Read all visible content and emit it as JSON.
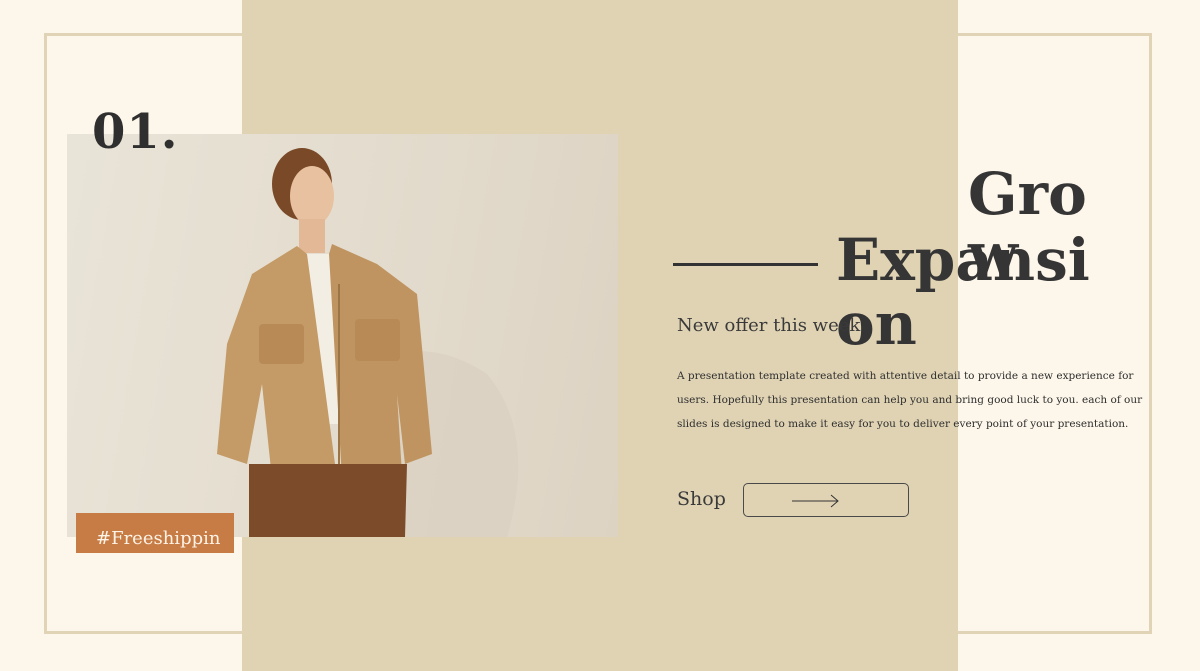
{
  "slide": {
    "number": "01.",
    "promo_tag": "#Freeshipping",
    "heading_back": "Grow",
    "heading_front": "Expansion",
    "subtitle": "New offer this week",
    "body": "A presentation template created with attentive detail to provide a new experience for users. Hopefully this presentation can help you and bring good luck to you. each of our slides is designed to make it easy for you to deliver every point of your presentation.",
    "shop_label": "Shop",
    "shop_button_icon": "arrow-right-icon"
  },
  "colors": {
    "page_background": "#fdf6ea",
    "band": "#e0d3b4",
    "frame": "#e1d3b5",
    "accent": "#c87c45",
    "text": "#2f2f2f"
  }
}
